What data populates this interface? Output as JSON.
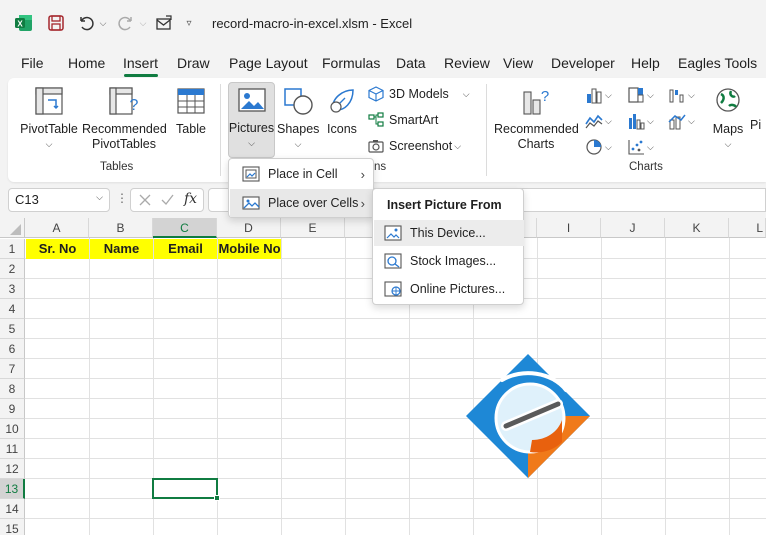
{
  "titlebar": {
    "title": "record-macro-in-excel.xlsm  -  Excel"
  },
  "tabs": [
    "File",
    "Home",
    "Insert",
    "Draw",
    "Page Layout",
    "Formulas",
    "Data",
    "Review",
    "View",
    "Developer",
    "Help",
    "Eagles Tools"
  ],
  "active_tab": "Insert",
  "ribbon": {
    "pivottable": "PivotTable",
    "recommended_pivottables_1": "Recommended",
    "recommended_pivottables_2": "PivotTables",
    "table": "Table",
    "tables_group": "Tables",
    "pictures": "Pictures",
    "shapes": "Shapes",
    "icons": "Icons",
    "models3d": "3D Models",
    "smartart": "SmartArt",
    "screenshot": "Screenshot",
    "illustrations_group_fragment": "ns",
    "recommended_charts_1": "Recommended",
    "recommended_charts_2": "Charts",
    "charts_group": "Charts",
    "maps": "Maps",
    "pivotchart_fragment": "Pi"
  },
  "formula_bar": {
    "name_box": "C13",
    "fx": "fx",
    "formula": ""
  },
  "columns": [
    "A",
    "B",
    "C",
    "D",
    "E",
    "F",
    "G",
    "H",
    "I",
    "J",
    "K",
    "L"
  ],
  "rows": [
    "1",
    "2",
    "3",
    "4",
    "5",
    "6",
    "7",
    "8",
    "9",
    "10",
    "11",
    "12",
    "13",
    "14",
    "15"
  ],
  "cells": {
    "A1": "Sr. No",
    "B1": "Name",
    "C1": "Email",
    "D1": "Mobile No"
  },
  "selected_cell": "C13",
  "pictures_menu": {
    "place_in_cell": "Place in Cell",
    "place_over_cells": "Place over Cells"
  },
  "insert_picture_menu": {
    "title": "Insert Picture From",
    "this_device": "This Device...",
    "stock_images": "Stock Images...",
    "online_pictures": "Online Pictures..."
  },
  "colors": {
    "excel_green": "#107c41",
    "header_fill": "#ffff00"
  }
}
